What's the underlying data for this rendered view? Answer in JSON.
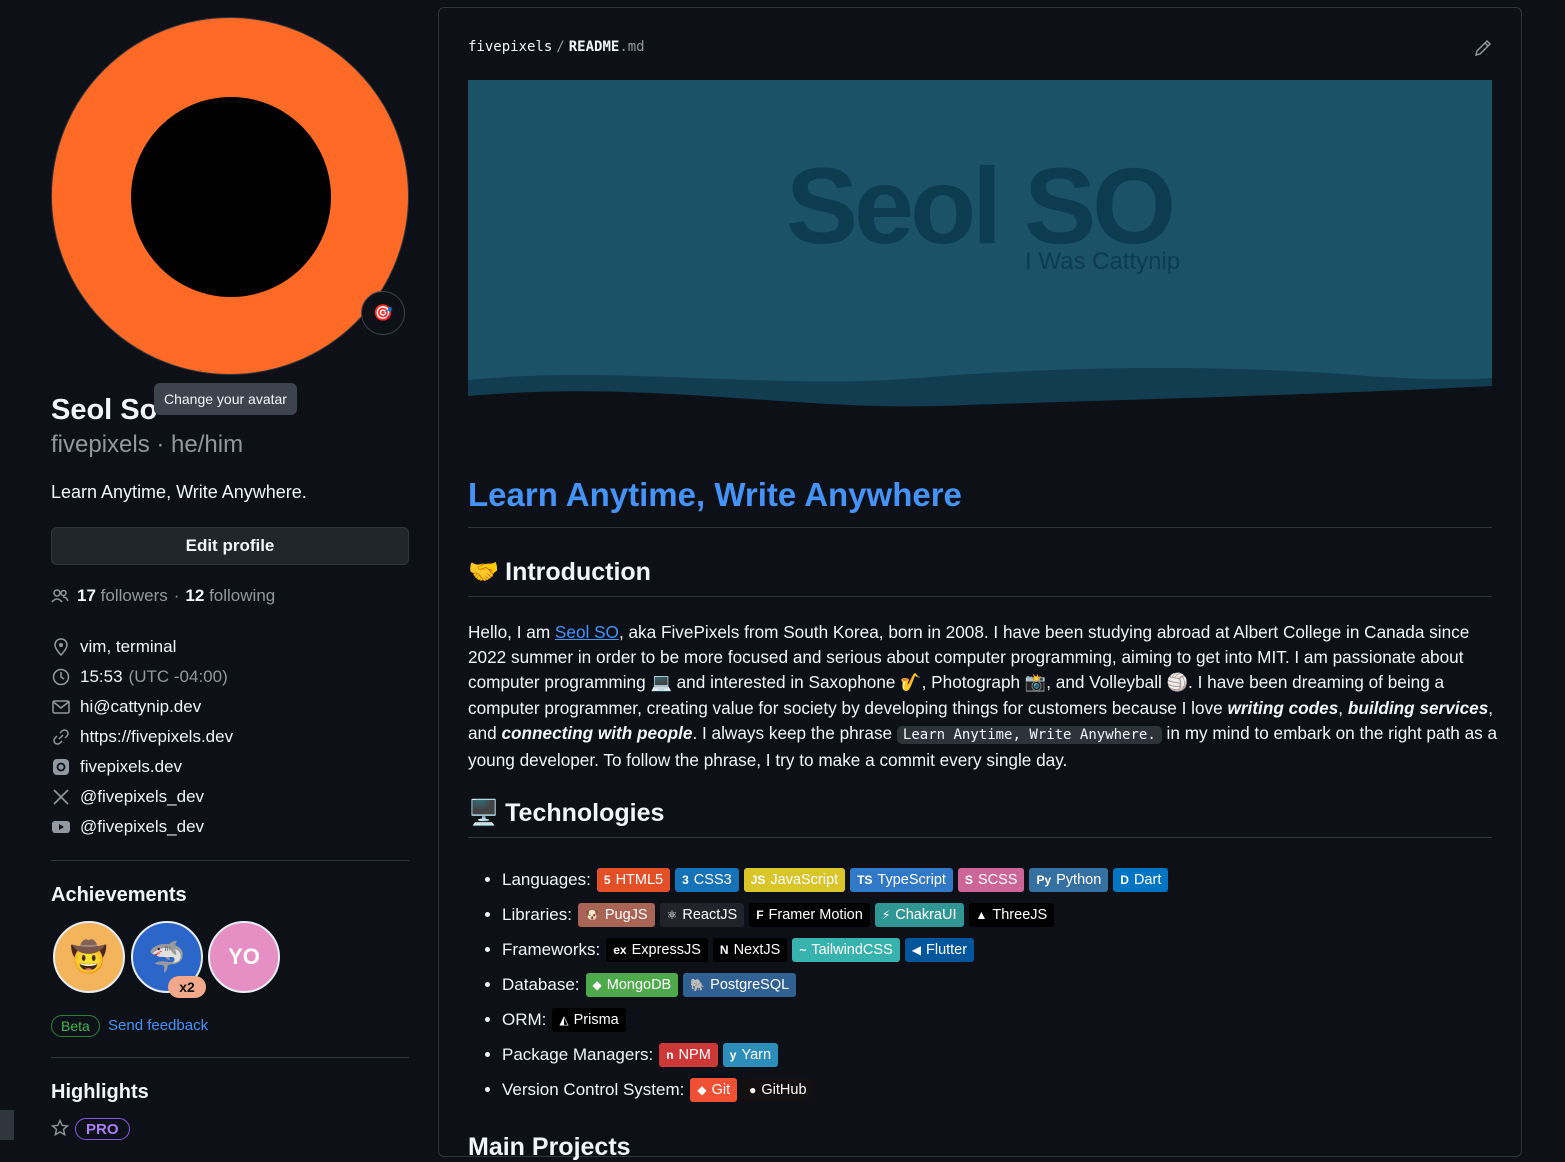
{
  "profile": {
    "display_name": "Seol So",
    "login_line": "fivepixels · he/him",
    "bio": "Learn Anytime, Write Anywhere.",
    "edit_profile_label": "Edit profile",
    "change_avatar_tooltip": "Change your avatar",
    "followers_count": "17",
    "followers_label": "followers",
    "separator": "·",
    "following_count": "12",
    "following_label": "following",
    "avatar_colors": {
      "ring": "#ff6b26",
      "center": "#000000"
    },
    "details": {
      "location": "vim, terminal",
      "time": "15:53",
      "timezone": "(UTC -04:00)",
      "email": "hi@cattynip.dev",
      "website": "https://fivepixels.dev",
      "instagram": "fivepixels.dev",
      "x": "@fivepixels_dev",
      "youtube": "@fivepixels_dev"
    }
  },
  "achievements": {
    "title": "Achievements",
    "badges": [
      "cowboy-badge",
      "shark-badge",
      "yolo-badge"
    ],
    "shark_count": "x2",
    "beta_label": "Beta",
    "feedback_label": "Send feedback"
  },
  "highlights": {
    "title": "Highlights",
    "pro_label": "PRO"
  },
  "readme": {
    "owner": "fivepixels",
    "slash": "/",
    "file": "README",
    "ext": ".md",
    "banner": {
      "title": "Seol SO",
      "subtitle": "I Was Cattynip",
      "bg": "#1b5268",
      "wave": "#123d50"
    },
    "heading": "Learn Anytime, Write Anywhere",
    "intro_title": "Introduction",
    "intro_emoji": "🤝",
    "intro": {
      "p1": "Hello, I am ",
      "link": "Seol SO",
      "p2": ", aka FivePixels from South Korea, born in 2008. I have been studying abroad at Albert College in Canada since 2022 summer in order to be more focused and serious about computer programming, aiming to get into MIT. I am passionate about computer programming 💻 and interested in Saxophone 🎷, Photograph 📸, and Volleyball 🏐. I have been dreaming of being a computer programmer, creating value for society by developing things for customers because I love ",
      "em1": "writing codes",
      "c1": ", ",
      "em2": "building services",
      "c2": ", and ",
      "em3": "connecting with people",
      "p3": ". I always keep the phrase ",
      "code": "Learn Anytime, Write Anywhere.",
      "p4": " in my mind to embark on the right path as a young developer. To follow the phrase, I try to make a commit every single day."
    },
    "tech_title": "Technologies",
    "tech_emoji": "🖥️",
    "tech": {
      "languages": {
        "label": "Languages:",
        "tags": [
          {
            "name": "HTML5",
            "color": "#e34f26",
            "icon": "5"
          },
          {
            "name": "CSS3",
            "color": "#1572b6",
            "icon": "3"
          },
          {
            "name": "JavaScript",
            "color": "#d9c42a",
            "icon": "JS"
          },
          {
            "name": "TypeScript",
            "color": "#3178c6",
            "icon": "TS"
          },
          {
            "name": "SCSS",
            "color": "#cc6699",
            "icon": "S"
          },
          {
            "name": "Python",
            "color": "#3670a0",
            "icon": "Py"
          },
          {
            "name": "Dart",
            "color": "#0175c2",
            "icon": "D"
          }
        ]
      },
      "libraries": {
        "label": "Libraries:",
        "tags": [
          {
            "name": "PugJS",
            "color": "#a86454",
            "icon": "🐶"
          },
          {
            "name": "ReactJS",
            "color": "#20232a",
            "icon": "⚛"
          },
          {
            "name": "Framer Motion",
            "color": "#000000",
            "icon": "F"
          },
          {
            "name": "ChakraUI",
            "color": "#319795",
            "icon": "⚡"
          },
          {
            "name": "ThreeJS",
            "color": "#000000",
            "icon": "▲"
          }
        ]
      },
      "frameworks": {
        "label": "Frameworks:",
        "tags": [
          {
            "name": "ExpressJS",
            "color": "#000000",
            "icon": "ex"
          },
          {
            "name": "NextJS",
            "color": "#000000",
            "icon": "N"
          },
          {
            "name": "TailwindCSS",
            "color": "#38b2ac",
            "icon": "~"
          },
          {
            "name": "Flutter",
            "color": "#02569b",
            "icon": "◀"
          }
        ]
      },
      "database": {
        "label": "Database:",
        "tags": [
          {
            "name": "MongoDB",
            "color": "#4ea94b",
            "icon": "◆"
          },
          {
            "name": "PostgreSQL",
            "color": "#316192",
            "icon": "🐘"
          }
        ]
      },
      "orm": {
        "label": "ORM:",
        "tags": [
          {
            "name": "Prisma",
            "color": "#000000",
            "icon": "◭"
          }
        ]
      },
      "package_managers": {
        "label": "Package Managers:",
        "tags": [
          {
            "name": "NPM",
            "color": "#cb3837",
            "icon": "n"
          },
          {
            "name": "Yarn",
            "color": "#2c8ebb",
            "icon": "y"
          }
        ]
      },
      "vcs": {
        "label": "Version Control System:",
        "tags": [
          {
            "name": "Git",
            "color": "#f05033",
            "icon": "◆"
          },
          {
            "name": "GitHub",
            "color": "#121011",
            "icon": "●"
          }
        ]
      }
    },
    "next_section": "Main Projects"
  }
}
